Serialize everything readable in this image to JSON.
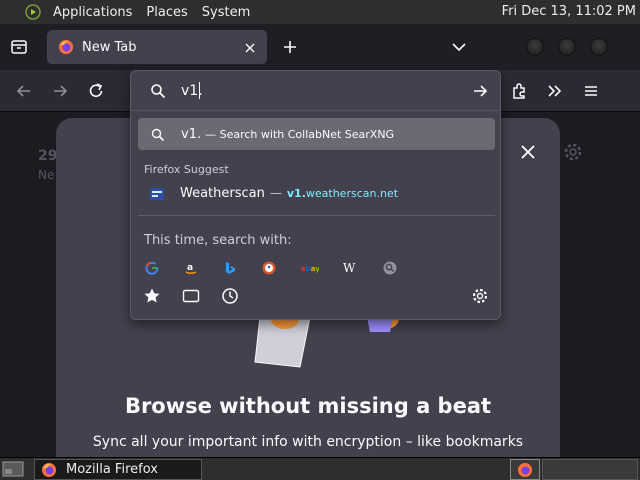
{
  "top_panel": {
    "applications": "Applications",
    "places": "Places",
    "system": "System",
    "clock": "Fri Dec 13, 11:02 PM"
  },
  "tabs": [
    {
      "title": "New Tab",
      "active": true
    }
  ],
  "urlbar": {
    "value": "v1.",
    "selected_result": {
      "text": "v1.",
      "action": "— Search with CollabNet SearXNG"
    },
    "group_label": "Firefox Suggest",
    "suggestion": {
      "title": "Weatherscan",
      "separator": "—",
      "url_bold": "v1.",
      "url_rest": "weatherscan.net"
    },
    "oneoff_label": "This time, search with:",
    "engines": [
      "google-icon",
      "amazon-icon",
      "bing-icon",
      "duckduckgo-icon",
      "ebay-icon",
      "wikipedia-icon",
      "searxng-icon"
    ],
    "modes": [
      "bookmarks-icon",
      "tabs-icon",
      "history-icon"
    ]
  },
  "newtab": {
    "ghost_number": "29",
    "ghost_text": "Ne",
    "promo_title": "Browse without missing a beat",
    "promo_desc": "Sync all your important info with encryption – like bookmarks"
  },
  "taskbar": {
    "window_title": "Mozilla Firefox"
  },
  "colors": {
    "accent_url": "#80ebff",
    "panel_bg": "#42414d",
    "selected_bg": "#6b6a73"
  }
}
